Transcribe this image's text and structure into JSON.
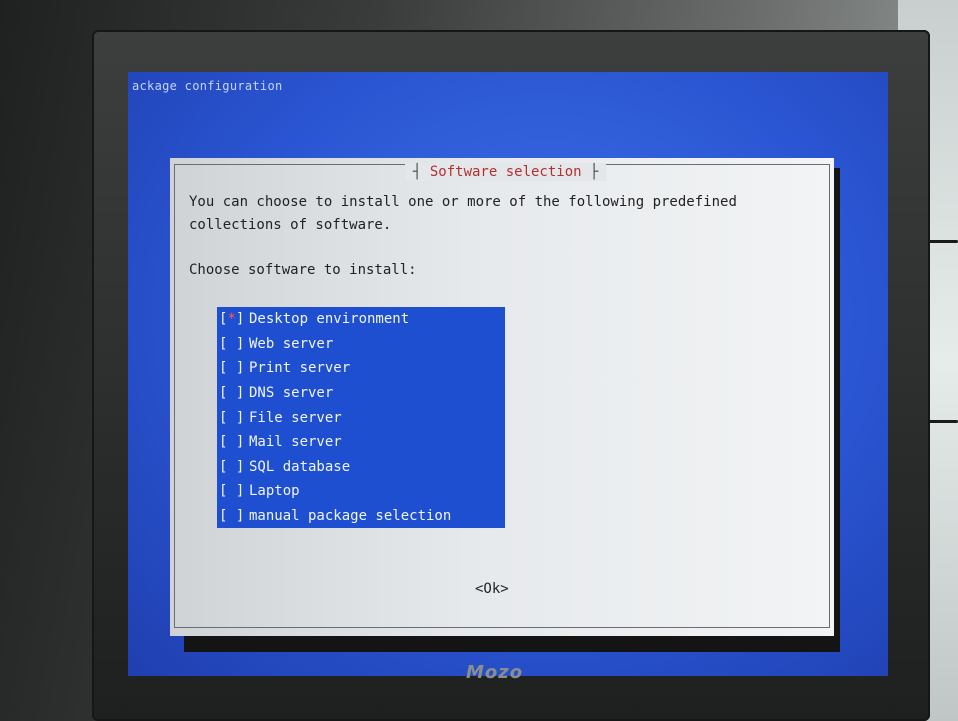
{
  "screen": {
    "window_title": "ackage configuration"
  },
  "dialog": {
    "title": "Software selection",
    "description": "You can choose to install one or more of the following predefined collections of software.",
    "prompt": "Choose software to install:",
    "items": [
      {
        "checkbox": "[*]",
        "label": "Desktop environment",
        "checked": true
      },
      {
        "checkbox": "[ ]",
        "label": "Web server",
        "checked": false
      },
      {
        "checkbox": "[ ]",
        "label": "Print server",
        "checked": false
      },
      {
        "checkbox": "[ ]",
        "label": "DNS server",
        "checked": false
      },
      {
        "checkbox": "[ ]",
        "label": "File server",
        "checked": false
      },
      {
        "checkbox": "[ ]",
        "label": "Mail server",
        "checked": false
      },
      {
        "checkbox": "[ ]",
        "label": "SQL database",
        "checked": false
      },
      {
        "checkbox": "[ ]",
        "label": "Laptop",
        "checked": false
      },
      {
        "checkbox": "[ ]",
        "label": "manual package selection",
        "checked": false
      }
    ],
    "ok_label": "<Ok>"
  },
  "monitor": {
    "brand": "Mozo"
  },
  "colors": {
    "screen_blue": "#2a55d2",
    "list_blue": "#1e4fd0",
    "dialog_gray": "#e6e9ec",
    "title_red": "#b33030"
  }
}
